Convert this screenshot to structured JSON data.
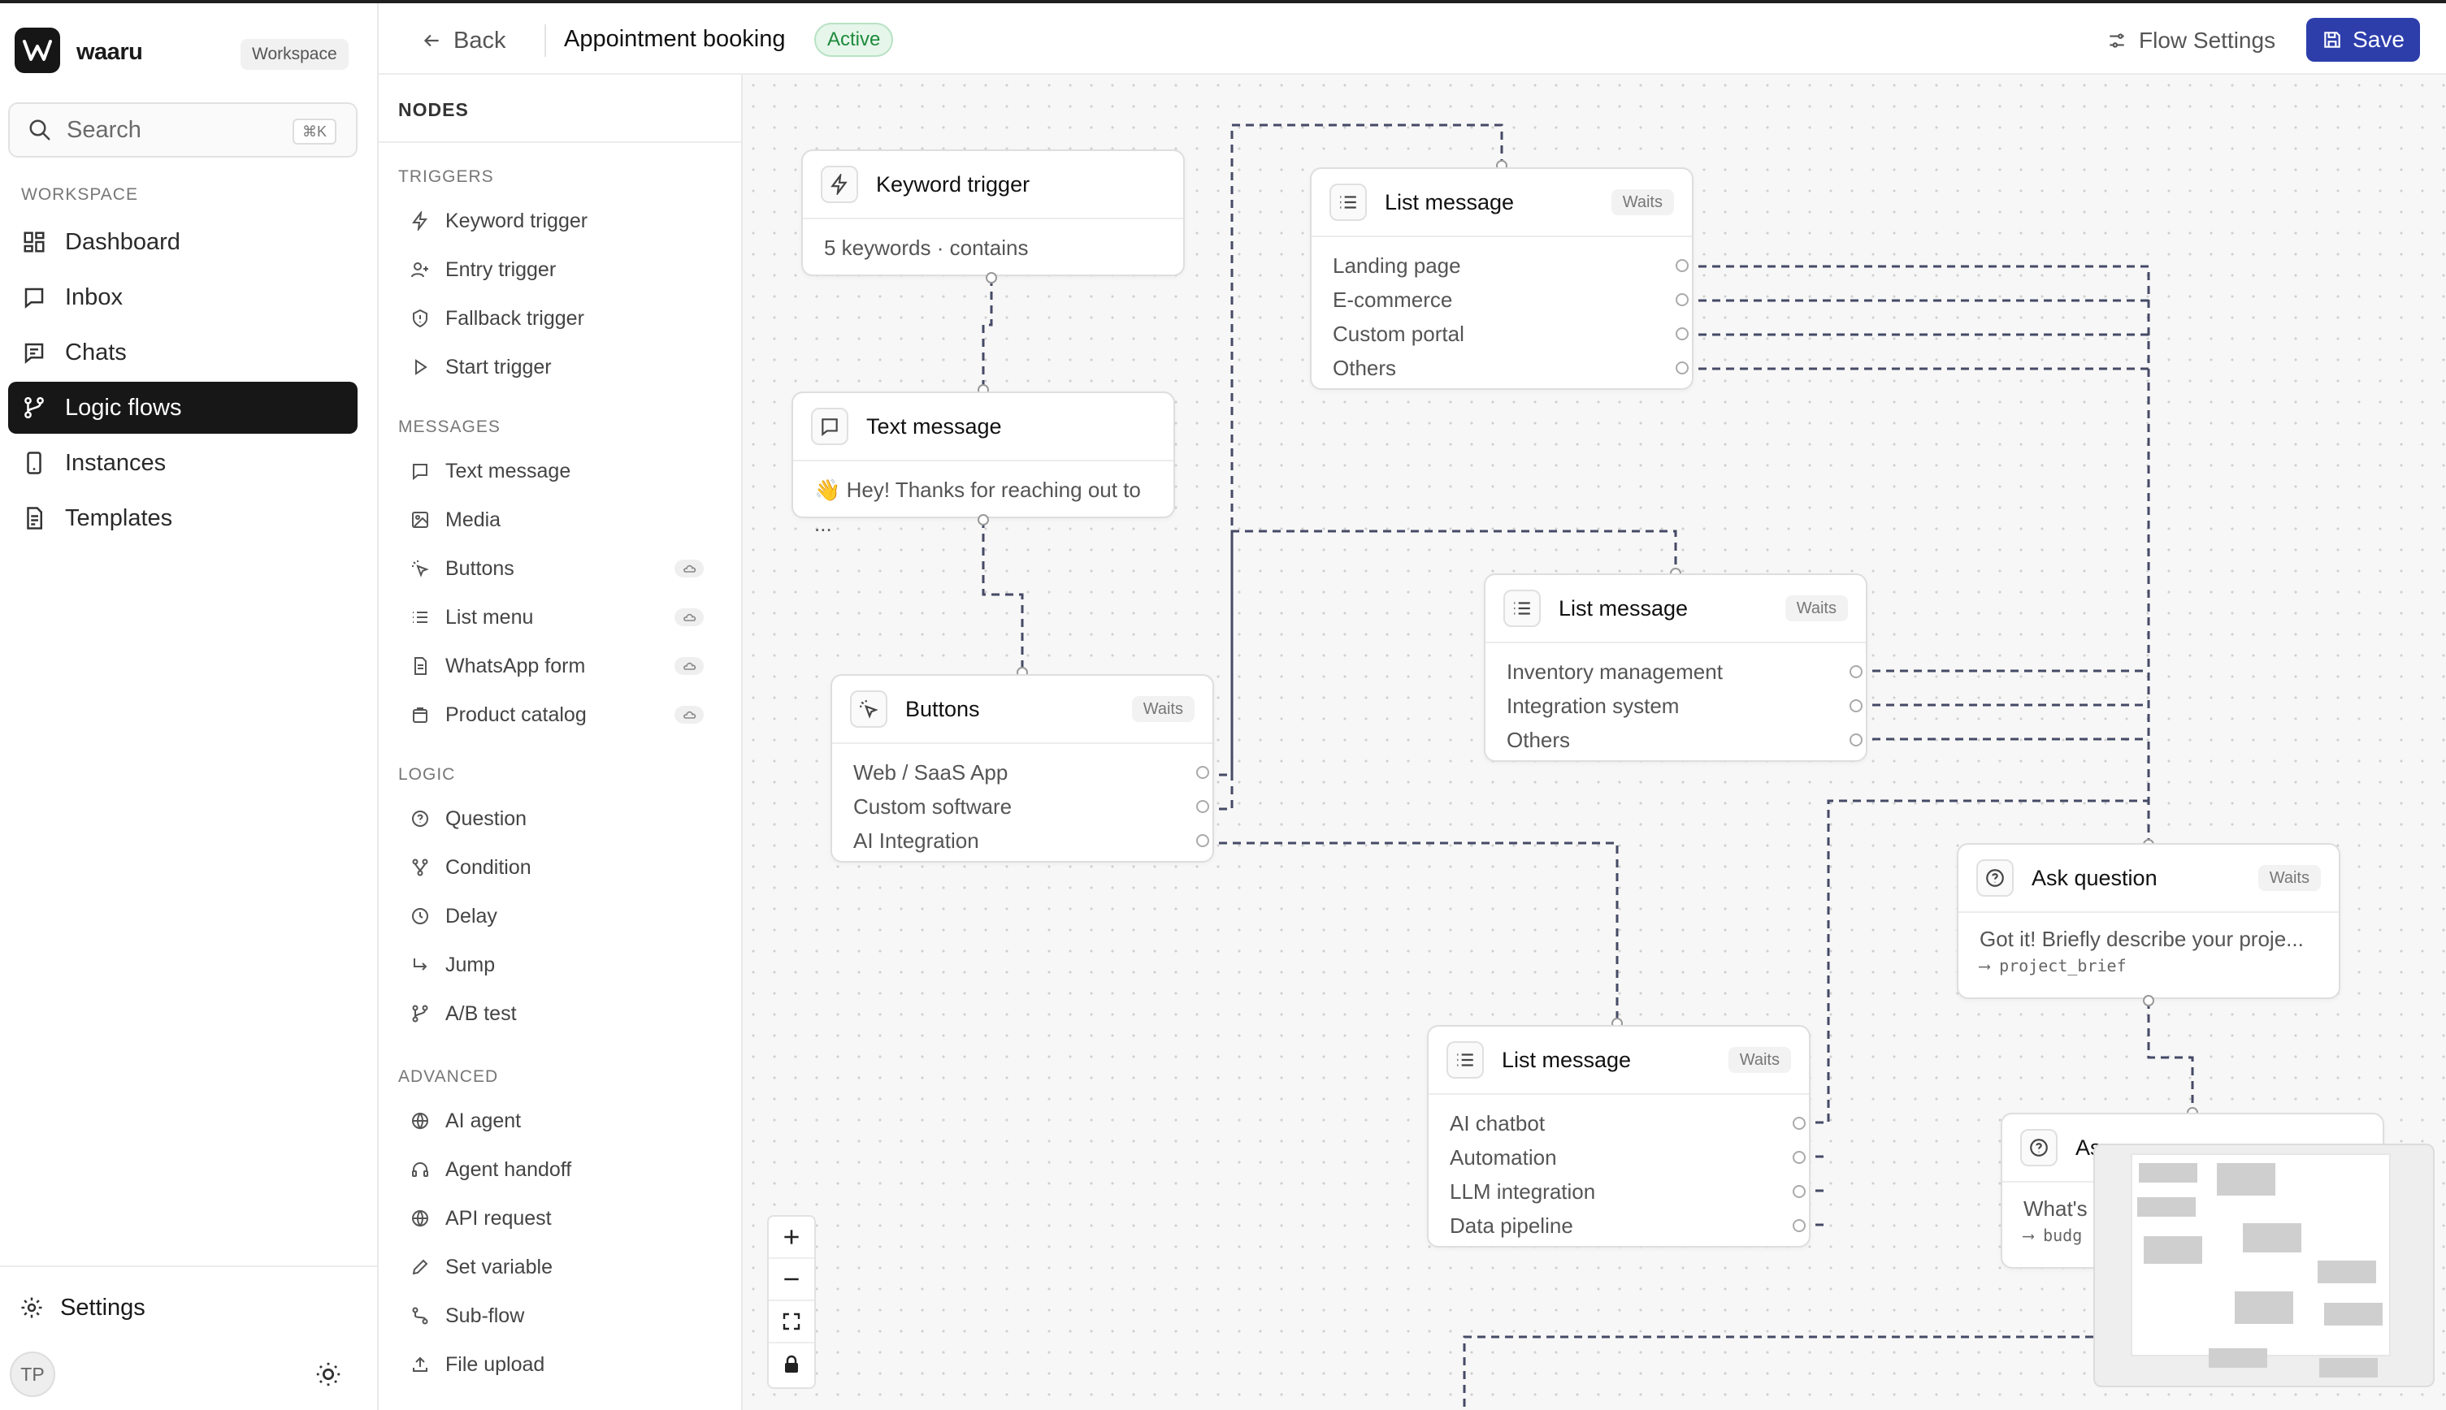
{
  "app": {
    "brand": "waaru",
    "workspace_badge": "Workspace"
  },
  "search": {
    "label": "Search",
    "shortcut": "⌘K"
  },
  "sidebar": {
    "section": "WORKSPACE",
    "items": [
      {
        "label": "Dashboard",
        "icon": "grid-icon"
      },
      {
        "label": "Inbox",
        "icon": "inbox-icon"
      },
      {
        "label": "Chats",
        "icon": "chat-icon"
      },
      {
        "label": "Logic flows",
        "icon": "flow-icon",
        "active": true
      },
      {
        "label": "Instances",
        "icon": "phone-icon"
      },
      {
        "label": "Templates",
        "icon": "document-icon"
      }
    ],
    "settings": "Settings",
    "avatar": "TP"
  },
  "header": {
    "back": "Back",
    "title": "Appointment booking",
    "status": "Active",
    "flow_settings": "Flow Settings",
    "save": "Save"
  },
  "palette": {
    "title": "NODES",
    "sections": [
      {
        "label": "TRIGGERS",
        "items": [
          "Keyword trigger",
          "Entry trigger",
          "Fallback trigger",
          "Start trigger"
        ]
      },
      {
        "label": "MESSAGES",
        "items": [
          "Text message",
          "Media",
          "Buttons",
          "List menu",
          "WhatsApp form",
          "Product catalog"
        ]
      },
      {
        "label": "LOGIC",
        "items": [
          "Question",
          "Condition",
          "Delay",
          "Jump",
          "A/B test"
        ]
      },
      {
        "label": "ADVANCED",
        "items": [
          "AI agent",
          "Agent handoff",
          "API request",
          "Set variable",
          "Sub-flow",
          "File upload"
        ]
      }
    ]
  },
  "nodes": {
    "keyword": {
      "title": "Keyword trigger",
      "body": "5 keywords · contains"
    },
    "text": {
      "title": "Text message",
      "body": "👋 Hey! Thanks for reaching out to ..."
    },
    "buttons": {
      "title": "Buttons",
      "waits": "Waits",
      "options": [
        "Web / SaaS App",
        "Custom software",
        "AI Integration"
      ]
    },
    "list1": {
      "title": "List message",
      "waits": "Waits",
      "options": [
        "Landing page",
        "E-commerce",
        "Custom portal",
        "Others"
      ]
    },
    "list2": {
      "title": "List message",
      "waits": "Waits",
      "options": [
        "Inventory management",
        "Integration system",
        "Others"
      ]
    },
    "ask1": {
      "title": "Ask question",
      "waits": "Waits",
      "body": "Got it! Briefly describe your proje...",
      "var": "⟶ project_brief"
    },
    "list3": {
      "title": "List message",
      "waits": "Waits",
      "options": [
        "AI chatbot",
        "Automation",
        "LLM integration",
        "Data pipeline"
      ]
    },
    "ask2": {
      "title": "As",
      "body": "What's",
      "var": "⟶ budg"
    }
  },
  "colors": {
    "accent": "#2d3eab",
    "active_nav": "#171717",
    "status_green": "#1e8a3c"
  }
}
